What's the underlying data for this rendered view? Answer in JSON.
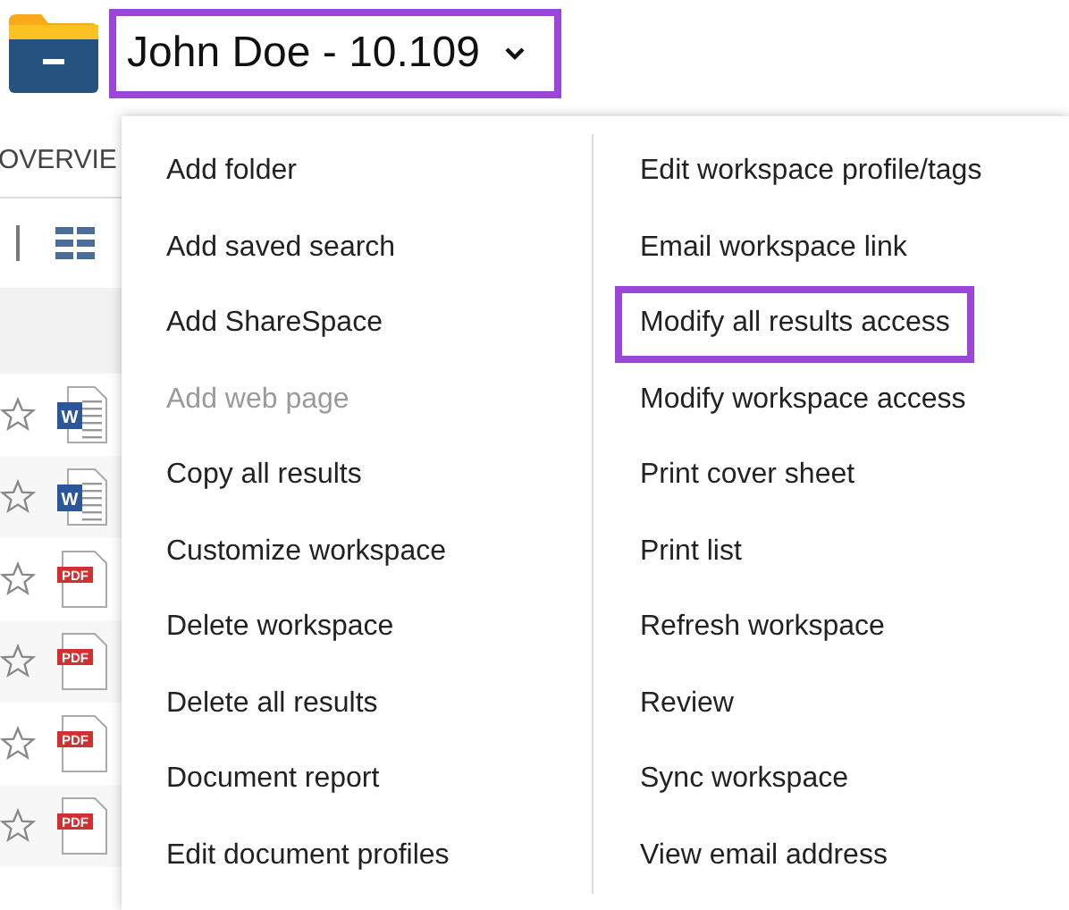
{
  "header": {
    "title": "John Doe - 10.109",
    "highlighted": true
  },
  "tabs": [
    {
      "label": "OVERVIE"
    }
  ],
  "rows": [
    {
      "kind": "word",
      "badge": "W",
      "starred": false
    },
    {
      "kind": "word",
      "badge": "W",
      "starred": false
    },
    {
      "kind": "pdf",
      "badge": "PDF",
      "starred": false
    },
    {
      "kind": "pdf",
      "badge": "PDF",
      "starred": false
    },
    {
      "kind": "pdf",
      "badge": "PDF",
      "starred": false
    },
    {
      "kind": "pdf",
      "badge": "PDF",
      "starred": false
    }
  ],
  "menu": {
    "columns": [
      [
        {
          "label": "Add folder",
          "disabled": false,
          "highlighted": false
        },
        {
          "label": "Add saved search",
          "disabled": false,
          "highlighted": false
        },
        {
          "label": "Add ShareSpace",
          "disabled": false,
          "highlighted": false
        },
        {
          "label": "Add web page",
          "disabled": true,
          "highlighted": false
        },
        {
          "label": "Copy all results",
          "disabled": false,
          "highlighted": false
        },
        {
          "label": "Customize workspace",
          "disabled": false,
          "highlighted": false
        },
        {
          "label": "Delete workspace",
          "disabled": false,
          "highlighted": false
        },
        {
          "label": "Delete all results",
          "disabled": false,
          "highlighted": false
        },
        {
          "label": "Document report",
          "disabled": false,
          "highlighted": false
        },
        {
          "label": "Edit document profiles",
          "disabled": false,
          "highlighted": false
        }
      ],
      [
        {
          "label": "Edit workspace profile/tags",
          "disabled": false,
          "highlighted": false
        },
        {
          "label": "Email workspace link",
          "disabled": false,
          "highlighted": false
        },
        {
          "label": "Modify all results access",
          "disabled": false,
          "highlighted": true
        },
        {
          "label": "Modify workspace access",
          "disabled": false,
          "highlighted": false
        },
        {
          "label": "Print cover sheet",
          "disabled": false,
          "highlighted": false
        },
        {
          "label": "Print list",
          "disabled": false,
          "highlighted": false
        },
        {
          "label": "Refresh workspace",
          "disabled": false,
          "highlighted": false
        },
        {
          "label": "Review",
          "disabled": false,
          "highlighted": false
        },
        {
          "label": "Sync workspace",
          "disabled": false,
          "highlighted": false
        },
        {
          "label": "View email address",
          "disabled": false,
          "highlighted": false
        }
      ]
    ]
  }
}
